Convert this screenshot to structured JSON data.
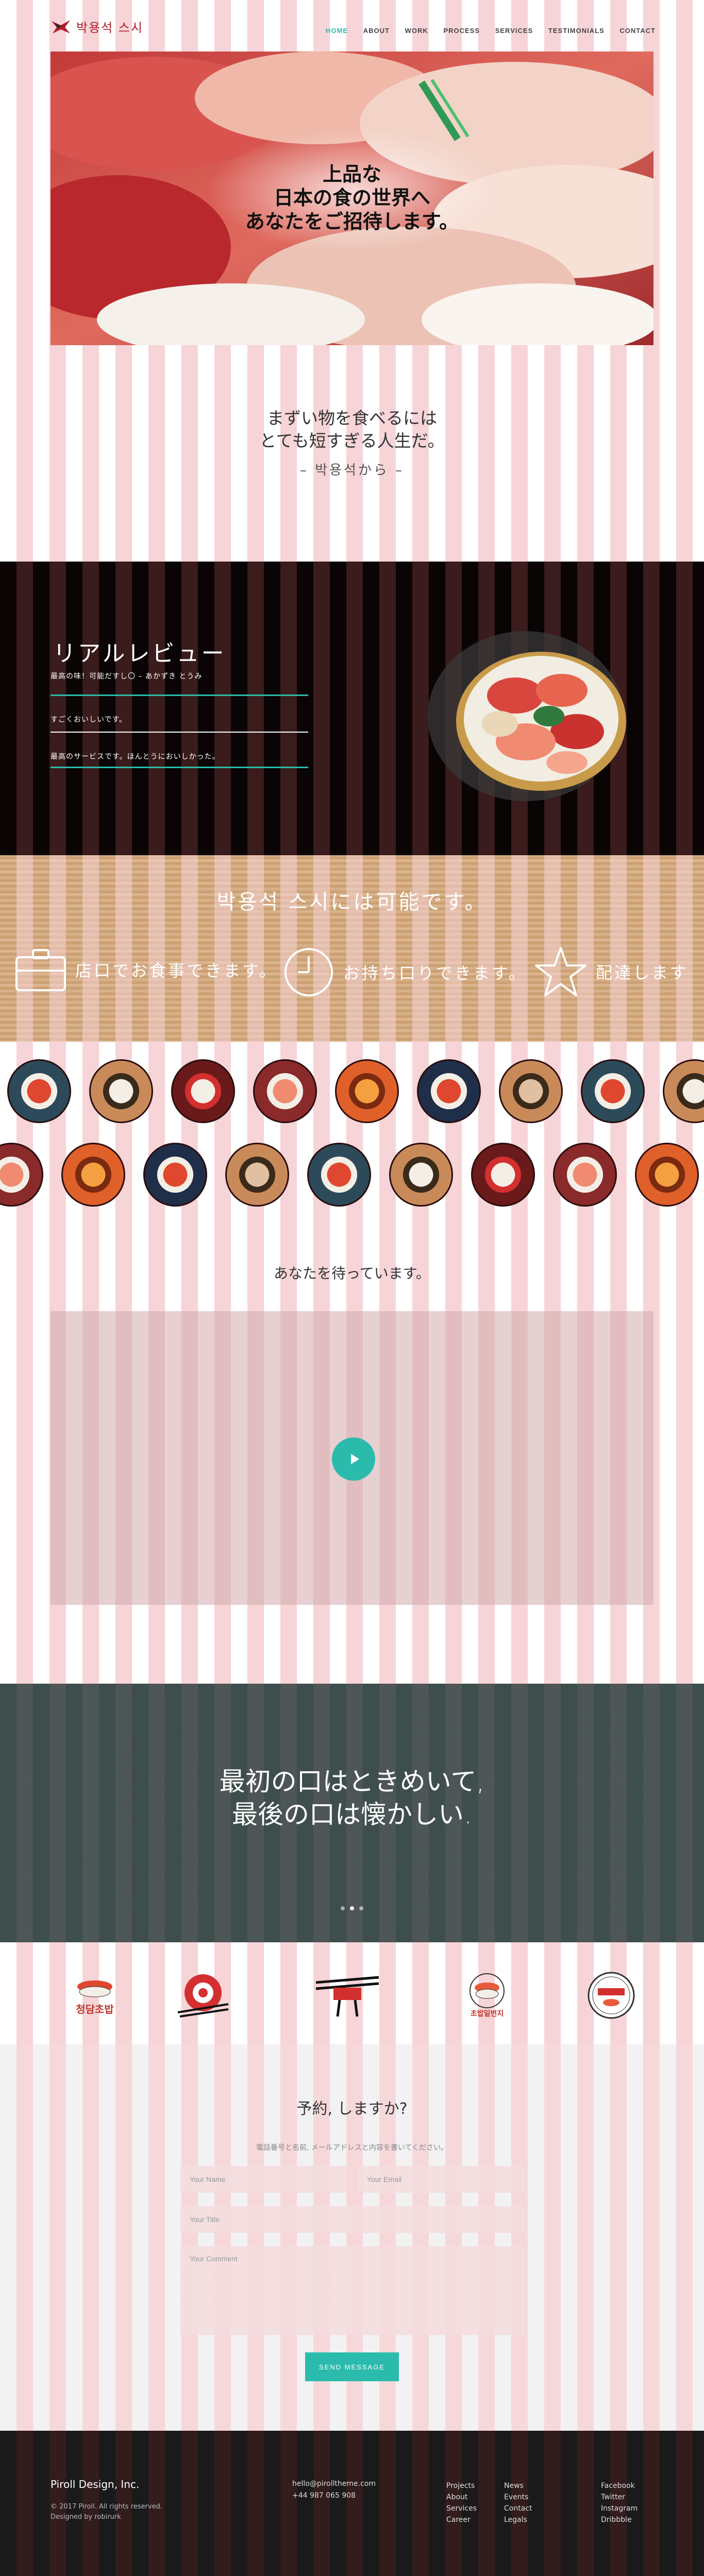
{
  "brand": {
    "logo_text": "박용석 스시"
  },
  "nav": {
    "items": [
      "HOME",
      "ABOUT",
      "WORK",
      "PROCESS",
      "SERVICES",
      "TESTIMONIALS",
      "CONTACT"
    ],
    "active": "HOME"
  },
  "hero": {
    "lines": [
      "上品な",
      "日本の食の世界へ",
      "あなたをご招待します。"
    ]
  },
  "quote": {
    "lines": [
      "まずい物を食べるには",
      "とても短すぎる人生だ。"
    ],
    "author": "– 박용석から –"
  },
  "reviews": {
    "title": "リアルレビュー",
    "items": [
      "最高の味！可能だすし〇 – あかずき とうみ",
      "すごくおいしいです。",
      "最高のサービスです。ほんとうにおいしかった。"
    ]
  },
  "features": {
    "title": "박용석 스시には可能です。",
    "items": [
      {
        "label": "店口でお食事できます。",
        "icon": "briefcase-icon"
      },
      {
        "label": "お持ち口りできます。",
        "icon": "clock-icon"
      },
      {
        "label": "配達します",
        "icon": "star-icon"
      }
    ]
  },
  "waiting": {
    "text": "あなたを待っています。"
  },
  "band": {
    "lines": [
      "最初の口はときめいて,",
      "最後の口は懐かしい."
    ]
  },
  "partners": {
    "items": [
      {
        "text": "청담초밥",
        "icon": "sushi-logo"
      },
      {
        "text": "",
        "icon": "roll-logo"
      },
      {
        "text": "",
        "icon": "chopsticks-logo"
      },
      {
        "text": "초밥일번지",
        "icon": "nigiri-logo"
      },
      {
        "text": "",
        "icon": "badge-logo"
      }
    ]
  },
  "contact": {
    "title": "予約, しますか?",
    "subtitle": "電話番号と名前, メールアドレスと内容を書いてください。",
    "name_placeholder": "Your Name",
    "email_placeholder": "Your Email",
    "title_placeholder": "Your Title",
    "comment_placeholder": "Your Comment",
    "send_label": "SEND MESSAGE"
  },
  "footer": {
    "company": "Piroll Design, Inc.",
    "copyright": "© 2017 Piroll. All rights reserved.",
    "designer": "Designed by robirurk",
    "email": "hello@pirollthеme.com",
    "phone": "+44 987 065 908",
    "col1": [
      "Projects",
      "About",
      "Services",
      "Career"
    ],
    "col2": [
      "News",
      "Events",
      "Contact",
      "Legals"
    ],
    "col3": [
      "Facebook",
      "Twitter",
      "Instagram",
      "Dribbble"
    ]
  },
  "colors": {
    "accent": "#2bbbad",
    "brand_red": "#b01e2c",
    "stripe_pink": "#f7d4d7"
  }
}
